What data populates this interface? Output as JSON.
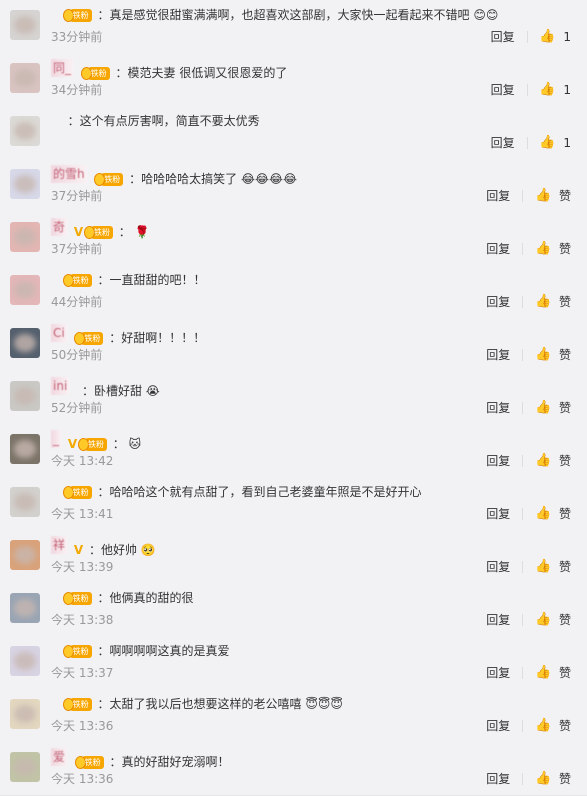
{
  "comments": [
    {
      "name": "",
      "name_suffix": "",
      "vip": "",
      "badge": "铁粉",
      "text": "：真是感觉很甜蜜满满啊，也超喜欢这部剧，大家快一起看起来不错吧",
      "emoji": "😊😊",
      "time": "33分钟前",
      "reply": "回复",
      "like": "1"
    },
    {
      "name": "",
      "name_suffix": "同_",
      "vip": "",
      "badge": "铁粉",
      "text": "：模范夫妻 很低调又很恩爱的了",
      "emoji": "",
      "time": "34分钟前",
      "reply": "回复",
      "like": "1"
    },
    {
      "name": "",
      "name_suffix": "",
      "vip": "",
      "badge": "",
      "text": "：这个有点厉害啊，简直不要太优秀",
      "emoji": "",
      "time": "",
      "reply": "回复",
      "like": "1"
    },
    {
      "name": "",
      "name_suffix": "的雪h",
      "vip": "",
      "badge": "铁粉",
      "text": "：哈哈哈哈太搞笑了",
      "emoji": "😂😂😂😂",
      "time": "37分钟前",
      "reply": "回复",
      "like": "赞"
    },
    {
      "name": "",
      "name_suffix": "奇",
      "vip": "V",
      "badge": "铁粉",
      "text": "：",
      "emoji": "🌹",
      "time": "37分钟前",
      "reply": "回复",
      "like": "赞"
    },
    {
      "name": "",
      "name_suffix": "",
      "vip": "",
      "badge": "铁粉",
      "text": "：一直甜甜的吧！！",
      "emoji": "",
      "time": "44分钟前",
      "reply": "回复",
      "like": "赞"
    },
    {
      "name": "",
      "name_suffix": "Ci",
      "vip": "",
      "badge": "铁粉",
      "text": "：好甜啊！！！！",
      "emoji": "",
      "time": "50分钟前",
      "reply": "回复",
      "like": "赞"
    },
    {
      "name": "",
      "name_suffix": "ini",
      "vip": "",
      "badge": "",
      "text": "：卧槽好甜",
      "emoji": "😭",
      "time": "52分钟前",
      "reply": "回复",
      "like": "赞"
    },
    {
      "name": "",
      "name_suffix": "_",
      "vip": "V",
      "badge": "铁粉",
      "text": "：",
      "emoji": "🐱",
      "time": "今天 13:42",
      "reply": "回复",
      "like": "赞"
    },
    {
      "name": "",
      "name_suffix": "",
      "vip": "",
      "badge": "铁粉",
      "text": "：哈哈哈这个就有点甜了，看到自己老婆童年照是不是好开心",
      "emoji": "",
      "time": "今天 13:41",
      "reply": "回复",
      "like": "赞"
    },
    {
      "name": "",
      "name_suffix": "祥",
      "vip": "V",
      "badge": "",
      "text": "：他好帅",
      "emoji": "🥺",
      "time": "今天 13:39",
      "reply": "回复",
      "like": "赞"
    },
    {
      "name": "",
      "name_suffix": "",
      "vip": "",
      "badge": "铁粉",
      "text": "：他俩真的甜的很",
      "emoji": "",
      "time": "今天 13:38",
      "reply": "回复",
      "like": "赞"
    },
    {
      "name": "",
      "name_suffix": "",
      "vip": "",
      "badge": "铁粉",
      "text": "：啊啊啊啊这真的是真爱",
      "emoji": "",
      "time": "今天 13:37",
      "reply": "回复",
      "like": "赞"
    },
    {
      "name": "",
      "name_suffix": "",
      "vip": "",
      "badge": "铁粉",
      "text": "：太甜了我以后也想要这样的老公嘻嘻",
      "emoji": "😇😇😇",
      "time": "今天 13:36",
      "reply": "回复",
      "like": "赞"
    },
    {
      "name": "",
      "name_suffix": "爱",
      "vip": "",
      "badge": "铁粉",
      "text": "：真的好甜好宠溺啊！",
      "emoji": "",
      "time": "今天 13:36",
      "reply": "回复",
      "like": "赞"
    }
  ]
}
